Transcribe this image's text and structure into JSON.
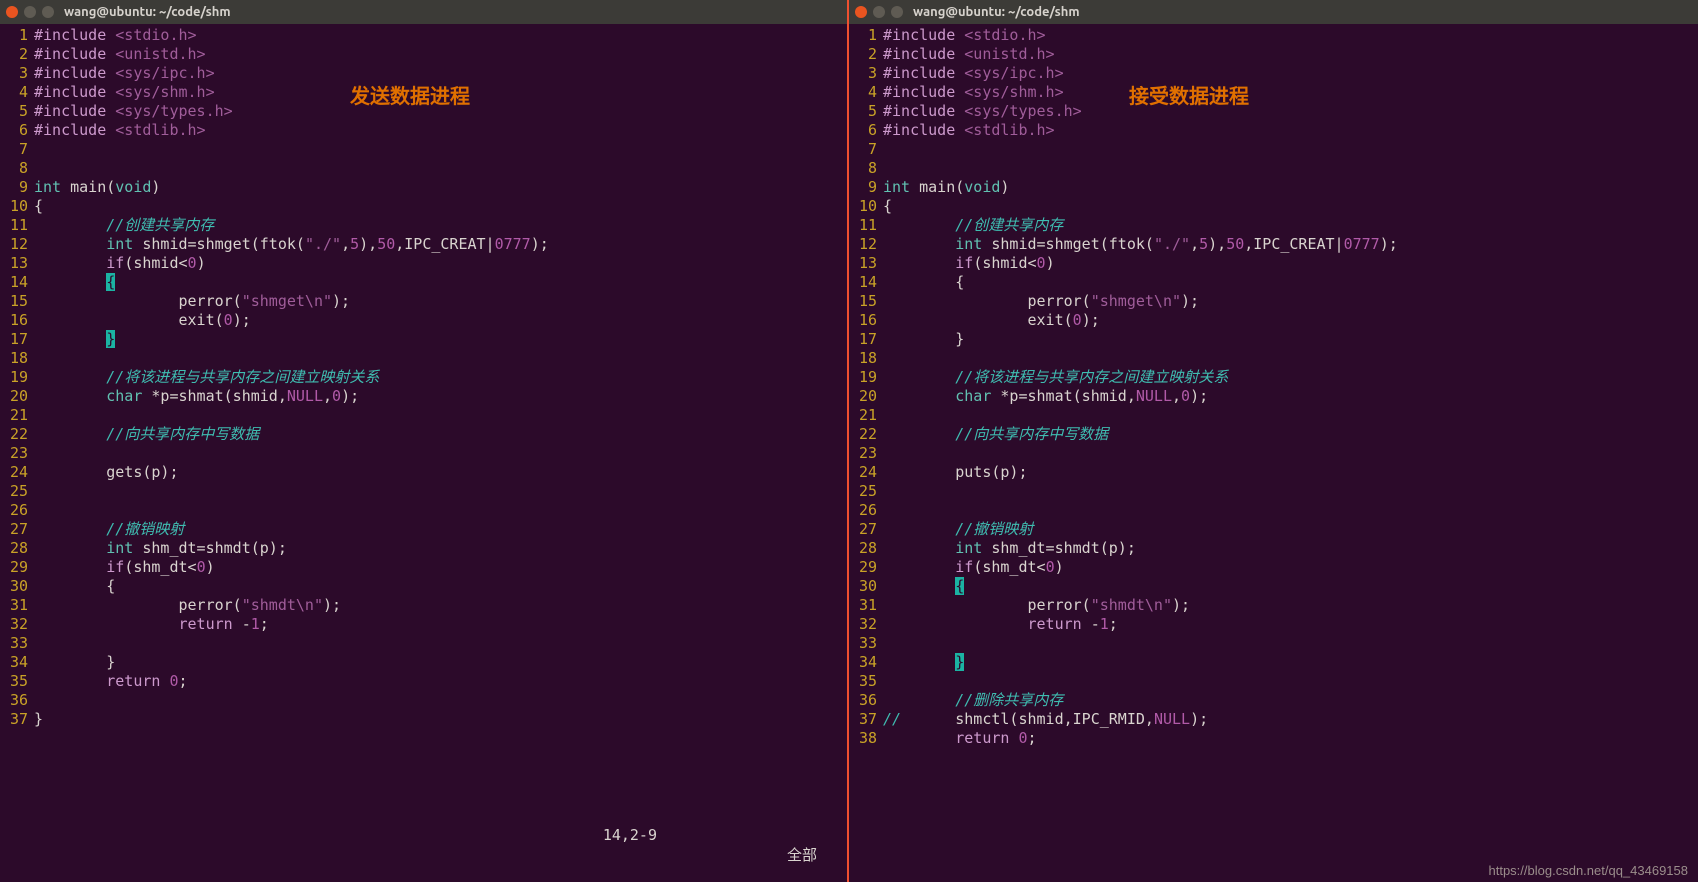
{
  "left": {
    "title": "wang@ubuntu: ~/code/shm",
    "label": "发送数据进程",
    "status_pos": "14,2-9",
    "status_mode": "全部",
    "lines": [
      {
        "n": "1",
        "seg": [
          {
            "c": "inc",
            "t": "#include "
          },
          {
            "c": "hdr",
            "t": "<stdio.h>"
          }
        ]
      },
      {
        "n": "2",
        "seg": [
          {
            "c": "inc",
            "t": "#include "
          },
          {
            "c": "hdr",
            "t": "<unistd.h>"
          }
        ]
      },
      {
        "n": "3",
        "seg": [
          {
            "c": "inc",
            "t": "#include "
          },
          {
            "c": "hdr",
            "t": "<sys/ipc.h>"
          }
        ]
      },
      {
        "n": "4",
        "seg": [
          {
            "c": "inc",
            "t": "#include "
          },
          {
            "c": "hdr",
            "t": "<sys/shm.h>"
          }
        ]
      },
      {
        "n": "5",
        "seg": [
          {
            "c": "inc",
            "t": "#include "
          },
          {
            "c": "hdr",
            "t": "<sys/types.h>"
          }
        ]
      },
      {
        "n": "6",
        "seg": [
          {
            "c": "inc",
            "t": "#include "
          },
          {
            "c": "hdr",
            "t": "<stdlib.h>"
          }
        ]
      },
      {
        "n": "7",
        "seg": []
      },
      {
        "n": "8",
        "seg": []
      },
      {
        "n": "9",
        "seg": [
          {
            "c": "ty",
            "t": "int"
          },
          {
            "c": "id",
            "t": " main("
          },
          {
            "c": "ty",
            "t": "void"
          },
          {
            "c": "id",
            "t": ")"
          }
        ]
      },
      {
        "n": "10",
        "seg": [
          {
            "c": "id",
            "t": "{"
          }
        ]
      },
      {
        "n": "11",
        "seg": [
          {
            "c": "id",
            "t": "        "
          },
          {
            "c": "cm",
            "t": "//创建共享内存"
          }
        ]
      },
      {
        "n": "12",
        "seg": [
          {
            "c": "id",
            "t": "        "
          },
          {
            "c": "ty",
            "t": "int"
          },
          {
            "c": "id",
            "t": " shmid=shmget(ftok("
          },
          {
            "c": "str",
            "t": "\"./\""
          },
          {
            "c": "id",
            "t": ","
          },
          {
            "c": "num",
            "t": "5"
          },
          {
            "c": "id",
            "t": "),"
          },
          {
            "c": "num",
            "t": "50"
          },
          {
            "c": "id",
            "t": ",IPC_CREAT|"
          },
          {
            "c": "num",
            "t": "0777"
          },
          {
            "c": "id",
            "t": ");"
          }
        ]
      },
      {
        "n": "13",
        "seg": [
          {
            "c": "id",
            "t": "        "
          },
          {
            "c": "kw",
            "t": "if"
          },
          {
            "c": "id",
            "t": "(shmid<"
          },
          {
            "c": "num",
            "t": "0"
          },
          {
            "c": "id",
            "t": ")"
          }
        ]
      },
      {
        "n": "14",
        "seg": [
          {
            "c": "id",
            "t": "        "
          },
          {
            "c": "hlb",
            "t": "{"
          }
        ]
      },
      {
        "n": "15",
        "seg": [
          {
            "c": "id",
            "t": "                perror("
          },
          {
            "c": "str",
            "t": "\"shmget\\n\""
          },
          {
            "c": "id",
            "t": ");"
          }
        ]
      },
      {
        "n": "16",
        "seg": [
          {
            "c": "id",
            "t": "                exit("
          },
          {
            "c": "num",
            "t": "0"
          },
          {
            "c": "id",
            "t": ");"
          }
        ]
      },
      {
        "n": "17",
        "seg": [
          {
            "c": "id",
            "t": "        "
          },
          {
            "c": "hlb",
            "t": "}"
          }
        ]
      },
      {
        "n": "18",
        "seg": []
      },
      {
        "n": "19",
        "seg": [
          {
            "c": "id",
            "t": "        "
          },
          {
            "c": "cm",
            "t": "//将该进程与共享内存之间建立映射关系"
          }
        ]
      },
      {
        "n": "20",
        "seg": [
          {
            "c": "id",
            "t": "        "
          },
          {
            "c": "ty",
            "t": "char"
          },
          {
            "c": "id",
            "t": " *p=shmat(shmid,"
          },
          {
            "c": "num",
            "t": "NULL"
          },
          {
            "c": "id",
            "t": ","
          },
          {
            "c": "num",
            "t": "0"
          },
          {
            "c": "id",
            "t": ");"
          }
        ]
      },
      {
        "n": "21",
        "seg": []
      },
      {
        "n": "22",
        "seg": [
          {
            "c": "id",
            "t": "        "
          },
          {
            "c": "cm",
            "t": "//向共享内存中写数据"
          }
        ]
      },
      {
        "n": "23",
        "seg": []
      },
      {
        "n": "24",
        "seg": [
          {
            "c": "id",
            "t": "        gets(p);"
          }
        ]
      },
      {
        "n": "25",
        "seg": []
      },
      {
        "n": "26",
        "seg": []
      },
      {
        "n": "27",
        "seg": [
          {
            "c": "id",
            "t": "        "
          },
          {
            "c": "cm",
            "t": "//撤销映射"
          }
        ]
      },
      {
        "n": "28",
        "seg": [
          {
            "c": "id",
            "t": "        "
          },
          {
            "c": "ty",
            "t": "int"
          },
          {
            "c": "id",
            "t": " shm_dt=shmdt(p);"
          }
        ]
      },
      {
        "n": "29",
        "seg": [
          {
            "c": "id",
            "t": "        "
          },
          {
            "c": "kw",
            "t": "if"
          },
          {
            "c": "id",
            "t": "(shm_dt<"
          },
          {
            "c": "num",
            "t": "0"
          },
          {
            "c": "id",
            "t": ")"
          }
        ]
      },
      {
        "n": "30",
        "seg": [
          {
            "c": "id",
            "t": "        {"
          }
        ]
      },
      {
        "n": "31",
        "seg": [
          {
            "c": "id",
            "t": "                perror("
          },
          {
            "c": "str",
            "t": "\"shmdt\\n\""
          },
          {
            "c": "id",
            "t": ");"
          }
        ]
      },
      {
        "n": "32",
        "seg": [
          {
            "c": "id",
            "t": "                "
          },
          {
            "c": "kw",
            "t": "return"
          },
          {
            "c": "id",
            "t": " -"
          },
          {
            "c": "num",
            "t": "1"
          },
          {
            "c": "id",
            "t": ";"
          }
        ]
      },
      {
        "n": "33",
        "seg": []
      },
      {
        "n": "34",
        "seg": [
          {
            "c": "id",
            "t": "        }"
          }
        ]
      },
      {
        "n": "35",
        "seg": [
          {
            "c": "id",
            "t": "        "
          },
          {
            "c": "kw",
            "t": "return"
          },
          {
            "c": "id",
            "t": " "
          },
          {
            "c": "num",
            "t": "0"
          },
          {
            "c": "id",
            "t": ";"
          }
        ]
      },
      {
        "n": "36",
        "seg": []
      },
      {
        "n": "37",
        "seg": [
          {
            "c": "id",
            "t": "}"
          }
        ]
      }
    ]
  },
  "right": {
    "title": "wang@ubuntu: ~/code/shm",
    "label": "接受数据进程",
    "watermark": "https://blog.csdn.net/qq_43469158",
    "lines": [
      {
        "n": "1",
        "seg": [
          {
            "c": "inc",
            "t": "#include "
          },
          {
            "c": "hdr",
            "t": "<stdio.h>"
          }
        ]
      },
      {
        "n": "2",
        "seg": [
          {
            "c": "inc",
            "t": "#include "
          },
          {
            "c": "hdr",
            "t": "<unistd.h>"
          }
        ]
      },
      {
        "n": "3",
        "seg": [
          {
            "c": "inc",
            "t": "#include "
          },
          {
            "c": "hdr",
            "t": "<sys/ipc.h>"
          }
        ]
      },
      {
        "n": "4",
        "seg": [
          {
            "c": "inc",
            "t": "#include "
          },
          {
            "c": "hdr",
            "t": "<sys/shm.h>"
          }
        ]
      },
      {
        "n": "5",
        "seg": [
          {
            "c": "inc",
            "t": "#include "
          },
          {
            "c": "hdr",
            "t": "<sys/types.h>"
          }
        ]
      },
      {
        "n": "6",
        "seg": [
          {
            "c": "inc",
            "t": "#include "
          },
          {
            "c": "hdr",
            "t": "<stdlib.h>"
          }
        ]
      },
      {
        "n": "7",
        "seg": []
      },
      {
        "n": "8",
        "seg": []
      },
      {
        "n": "9",
        "seg": [
          {
            "c": "ty",
            "t": "int"
          },
          {
            "c": "id",
            "t": " main("
          },
          {
            "c": "ty",
            "t": "void"
          },
          {
            "c": "id",
            "t": ")"
          }
        ]
      },
      {
        "n": "10",
        "seg": [
          {
            "c": "id",
            "t": "{"
          }
        ]
      },
      {
        "n": "11",
        "seg": [
          {
            "c": "id",
            "t": "        "
          },
          {
            "c": "cm",
            "t": "//创建共享内存"
          }
        ]
      },
      {
        "n": "12",
        "seg": [
          {
            "c": "id",
            "t": "        "
          },
          {
            "c": "ty",
            "t": "int"
          },
          {
            "c": "id",
            "t": " shmid=shmget(ftok("
          },
          {
            "c": "str",
            "t": "\"./\""
          },
          {
            "c": "id",
            "t": ","
          },
          {
            "c": "num",
            "t": "5"
          },
          {
            "c": "id",
            "t": "),"
          },
          {
            "c": "num",
            "t": "50"
          },
          {
            "c": "id",
            "t": ",IPC_CREAT|"
          },
          {
            "c": "num",
            "t": "0777"
          },
          {
            "c": "id",
            "t": ");"
          }
        ]
      },
      {
        "n": "13",
        "seg": [
          {
            "c": "id",
            "t": "        "
          },
          {
            "c": "kw",
            "t": "if"
          },
          {
            "c": "id",
            "t": "(shmid<"
          },
          {
            "c": "num",
            "t": "0"
          },
          {
            "c": "id",
            "t": ")"
          }
        ]
      },
      {
        "n": "14",
        "seg": [
          {
            "c": "id",
            "t": "        {"
          }
        ]
      },
      {
        "n": "15",
        "seg": [
          {
            "c": "id",
            "t": "                perror("
          },
          {
            "c": "str",
            "t": "\"shmget\\n\""
          },
          {
            "c": "id",
            "t": ");"
          }
        ]
      },
      {
        "n": "16",
        "seg": [
          {
            "c": "id",
            "t": "                exit("
          },
          {
            "c": "num",
            "t": "0"
          },
          {
            "c": "id",
            "t": ");"
          }
        ]
      },
      {
        "n": "17",
        "seg": [
          {
            "c": "id",
            "t": "        }"
          }
        ]
      },
      {
        "n": "18",
        "seg": []
      },
      {
        "n": "19",
        "seg": [
          {
            "c": "id",
            "t": "        "
          },
          {
            "c": "cm",
            "t": "//将该进程与共享内存之间建立映射关系"
          }
        ]
      },
      {
        "n": "20",
        "seg": [
          {
            "c": "id",
            "t": "        "
          },
          {
            "c": "ty",
            "t": "char"
          },
          {
            "c": "id",
            "t": " *p=shmat(shmid,"
          },
          {
            "c": "num",
            "t": "NULL"
          },
          {
            "c": "id",
            "t": ","
          },
          {
            "c": "num",
            "t": "0"
          },
          {
            "c": "id",
            "t": ");"
          }
        ]
      },
      {
        "n": "21",
        "seg": []
      },
      {
        "n": "22",
        "seg": [
          {
            "c": "id",
            "t": "        "
          },
          {
            "c": "cm",
            "t": "//向共享内存中写数据"
          }
        ]
      },
      {
        "n": "23",
        "seg": []
      },
      {
        "n": "24",
        "seg": [
          {
            "c": "id",
            "t": "        puts(p);"
          }
        ]
      },
      {
        "n": "25",
        "seg": []
      },
      {
        "n": "26",
        "seg": []
      },
      {
        "n": "27",
        "seg": [
          {
            "c": "id",
            "t": "        "
          },
          {
            "c": "cm",
            "t": "//撤销映射"
          }
        ]
      },
      {
        "n": "28",
        "seg": [
          {
            "c": "id",
            "t": "        "
          },
          {
            "c": "ty",
            "t": "int"
          },
          {
            "c": "id",
            "t": " shm_dt=shmdt(p);"
          }
        ]
      },
      {
        "n": "29",
        "seg": [
          {
            "c": "id",
            "t": "        "
          },
          {
            "c": "kw",
            "t": "if"
          },
          {
            "c": "id",
            "t": "(shm_dt<"
          },
          {
            "c": "num",
            "t": "0"
          },
          {
            "c": "id",
            "t": ")"
          }
        ]
      },
      {
        "n": "30",
        "seg": [
          {
            "c": "id",
            "t": "        "
          },
          {
            "c": "hlb",
            "t": "{"
          }
        ]
      },
      {
        "n": "31",
        "seg": [
          {
            "c": "id",
            "t": "                perror("
          },
          {
            "c": "str",
            "t": "\"shmdt\\n\""
          },
          {
            "c": "id",
            "t": ");"
          }
        ]
      },
      {
        "n": "32",
        "seg": [
          {
            "c": "id",
            "t": "                "
          },
          {
            "c": "kw",
            "t": "return"
          },
          {
            "c": "id",
            "t": " -"
          },
          {
            "c": "num",
            "t": "1"
          },
          {
            "c": "id",
            "t": ";"
          }
        ]
      },
      {
        "n": "33",
        "seg": []
      },
      {
        "n": "34",
        "seg": [
          {
            "c": "id",
            "t": "        "
          },
          {
            "c": "hlb",
            "t": "}"
          }
        ]
      },
      {
        "n": "35",
        "seg": []
      },
      {
        "n": "36",
        "seg": [
          {
            "c": "id",
            "t": "        "
          },
          {
            "c": "cm",
            "t": "//删除共享内存"
          }
        ]
      },
      {
        "n": "37",
        "seg": [
          {
            "c": "cm",
            "t": "//"
          },
          {
            "c": "id",
            "t": "      shmctl(shmid,IPC_RMID,"
          },
          {
            "c": "num",
            "t": "NULL"
          },
          {
            "c": "id",
            "t": ");"
          }
        ]
      },
      {
        "n": "38",
        "seg": [
          {
            "c": "id",
            "t": "        "
          },
          {
            "c": "kw",
            "t": "return"
          },
          {
            "c": "id",
            "t": " "
          },
          {
            "c": "num",
            "t": "0"
          },
          {
            "c": "id",
            "t": ";"
          }
        ]
      }
    ]
  }
}
